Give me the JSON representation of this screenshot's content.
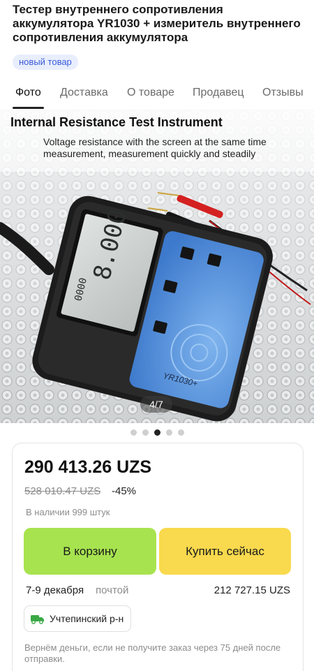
{
  "product": {
    "title": "Тестер внутреннего сопротивления аккумулятора YR1030 + измеритель внутреннего сопротивления аккумулятора",
    "badge": "новый товар"
  },
  "tabs": [
    {
      "label": "Фото",
      "active": true
    },
    {
      "label": "Доставка",
      "active": false
    },
    {
      "label": "О товаре",
      "active": false
    },
    {
      "label": "Продавец",
      "active": false
    },
    {
      "label": "Отзывы",
      "active": false
    }
  ],
  "gallery": {
    "image_title": "Internal Resistance Test Instrument",
    "image_subtitle": "Voltage resistance with the screen at the same time measurement, measurement quickly and steadily",
    "counter": "4/7",
    "device_model": "YR1030+",
    "page_count": 5,
    "active_page": 3
  },
  "purchase": {
    "price": "290 413.26 UZS",
    "old_price": "528 010.47 UZS",
    "discount": "-45%",
    "stock": "В наличии 999 штук",
    "add_to_cart_label": "В корзину",
    "buy_now_label": "Купить сейчас",
    "delivery_date": "7-9 декабря",
    "delivery_method": "почтой",
    "delivery_price": "212 727.15 UZS",
    "location": "Учтепинский р-н",
    "refund_note": "Вернём деньги, если не получите заказ через 75 дней после отправки."
  },
  "colors": {
    "cart_button": "#a7e34f",
    "buy_button": "#f9d94d",
    "badge_bg": "#e8eefc",
    "badge_text": "#3b5bdb",
    "delivery_icon": "#3aa845"
  }
}
